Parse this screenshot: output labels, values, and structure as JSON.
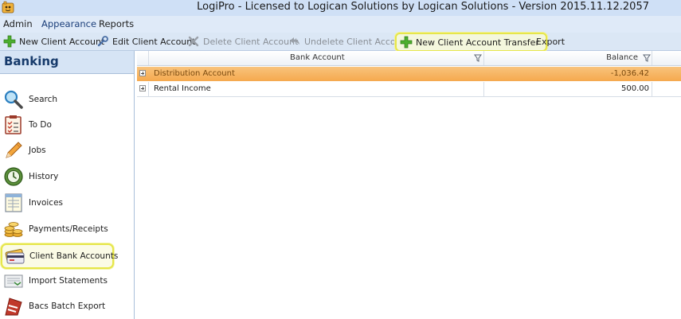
{
  "window": {
    "title": "LogiPro - Licensed to Logican Solutions by Logican Solutions - Version 2015.11.12.2057",
    "app_icon": "logipro-app-icon"
  },
  "menu": {
    "items": [
      "Admin",
      "Appearance",
      "Reports"
    ]
  },
  "toolbar": {
    "new_client_account": "New Client Account",
    "edit_client_account": "Edit Client Account",
    "delete_client_account": "Delete Client Account",
    "undelete_client_account": "Undelete Client Account",
    "new_client_account_transfer": "New Client Account Transfer",
    "export": "Export"
  },
  "sidebar": {
    "section": "Banking",
    "items": [
      {
        "label": "Search",
        "icon": "magnifier-icon"
      },
      {
        "label": "To Do",
        "icon": "checklist-icon"
      },
      {
        "label": "Jobs",
        "icon": "pencil-icon"
      },
      {
        "label": "History",
        "icon": "history-icon"
      },
      {
        "label": "Invoices",
        "icon": "invoice-icon"
      },
      {
        "label": "Payments/Receipts",
        "icon": "coins-icon"
      },
      {
        "label": "Client Bank Accounts",
        "icon": "bank-card-icon"
      },
      {
        "label": "Import Statements",
        "icon": "import-icon"
      },
      {
        "label": "Bacs Batch Export",
        "icon": "bacs-icon"
      }
    ],
    "selected": "Client Bank Accounts"
  },
  "grid": {
    "columns": [
      "Bank Account",
      "Balance"
    ],
    "rows": [
      {
        "account": "Distribution Account",
        "balance": "-1,036.42",
        "selected": true
      },
      {
        "account": "Rental Income",
        "balance": "500.00",
        "selected": false
      }
    ]
  },
  "colors": {
    "highlight_outline": "#e6e64a",
    "selected_row": "#f5a94e",
    "title_bar": "#cfe0f6",
    "sidebar_header_text": "#163a6b"
  }
}
